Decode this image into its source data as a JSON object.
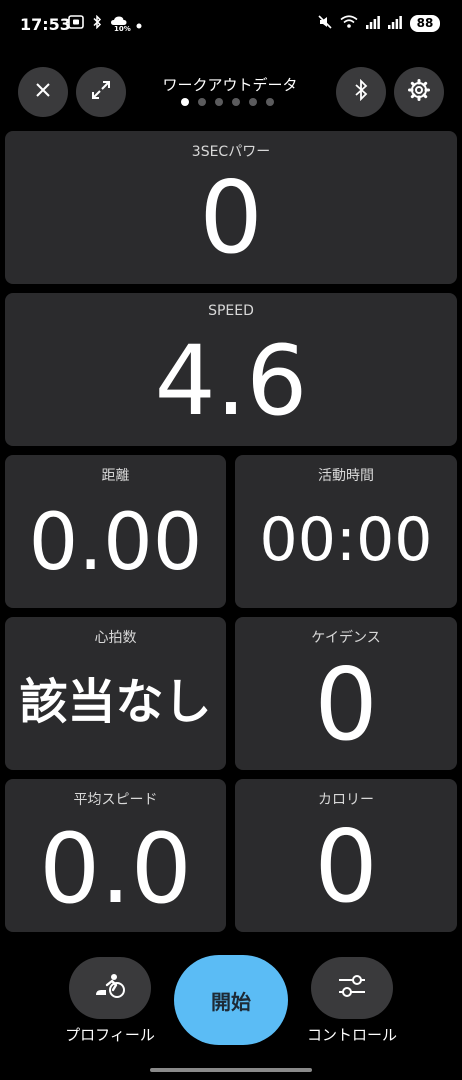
{
  "status_bar": {
    "time": "17:53",
    "weather_small": "10%",
    "battery": "88"
  },
  "header": {
    "title": "ワークアウトデータ",
    "pages": 6,
    "active_page": 0
  },
  "tiles": {
    "power": {
      "label": "3SECパワー",
      "value": "0"
    },
    "speed": {
      "label": "SPEED",
      "value": "4.6"
    },
    "distance": {
      "label": "距離",
      "value": "0.00"
    },
    "active_time": {
      "label": "活動時間",
      "value": "00:00"
    },
    "heart_rate": {
      "label": "心拍数",
      "value": "該当なし"
    },
    "cadence": {
      "label": "ケイデンス",
      "value": "0"
    },
    "avg_speed": {
      "label": "平均スピード",
      "value": "0.0"
    },
    "calories": {
      "label": "カロリー",
      "value": "0"
    }
  },
  "bottom": {
    "profile_label": "プロフィール",
    "start_label": "開始",
    "controls_label": "コントロール"
  },
  "colors": {
    "background": "#000000",
    "tile": "#2b2b2d",
    "round_button": "#3a3a3c",
    "start_button": "#5bbcf5",
    "text": "#ffffff"
  }
}
